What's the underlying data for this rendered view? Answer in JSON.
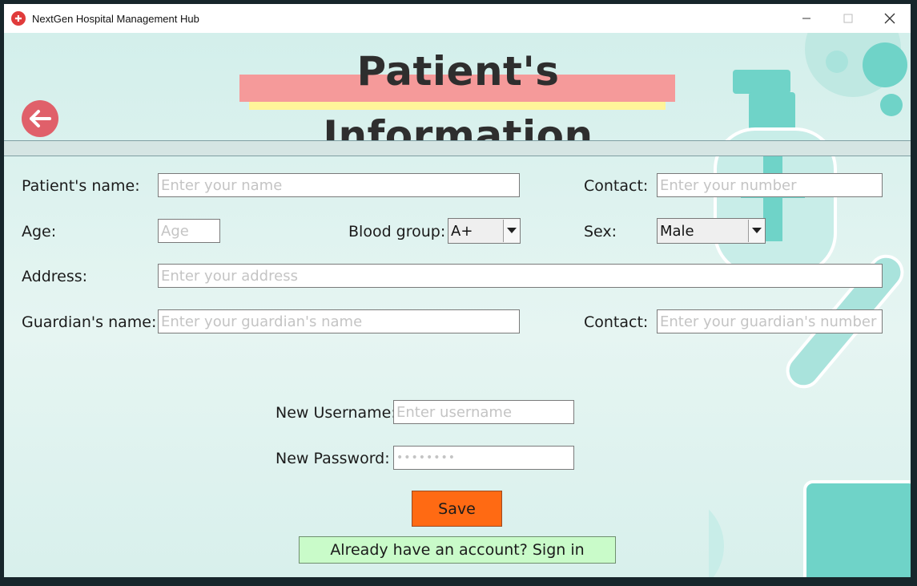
{
  "window": {
    "title": "NextGen Hospital Management Hub"
  },
  "page": {
    "title": "Patient's Information"
  },
  "icons": {
    "app": "hospital-app-icon",
    "back": "back-arrow-icon"
  },
  "colors": {
    "accent_save": "#ff6a13",
    "signin_bg": "#c9fbc9",
    "title_highlight": "#f59a9a",
    "title_underline": "#fff59a",
    "back_button": "#e0606a"
  },
  "form": {
    "patient_name": {
      "label": "Patient's name:",
      "placeholder": "Enter your name",
      "value": ""
    },
    "contact": {
      "label": "Contact:",
      "placeholder": "Enter your number",
      "value": ""
    },
    "age": {
      "label": "Age:",
      "placeholder": "Age",
      "value": ""
    },
    "blood_group": {
      "label": "Blood group:",
      "selected": "A+"
    },
    "sex": {
      "label": "Sex:",
      "selected": "Male"
    },
    "address": {
      "label": "Address:",
      "placeholder": "Enter your address",
      "value": ""
    },
    "guardian_name": {
      "label": "Guardian's name:",
      "placeholder": "Enter your guardian's name",
      "value": ""
    },
    "guardian_contact": {
      "label": "Contact:",
      "placeholder": "Enter your guardian's number",
      "value": ""
    },
    "username": {
      "label": "New Username:",
      "placeholder": "Enter username",
      "value": ""
    },
    "password": {
      "label": "New Password:",
      "value": "••••••••"
    }
  },
  "buttons": {
    "save": "Save",
    "signin": "Already have an account?  Sign in"
  }
}
